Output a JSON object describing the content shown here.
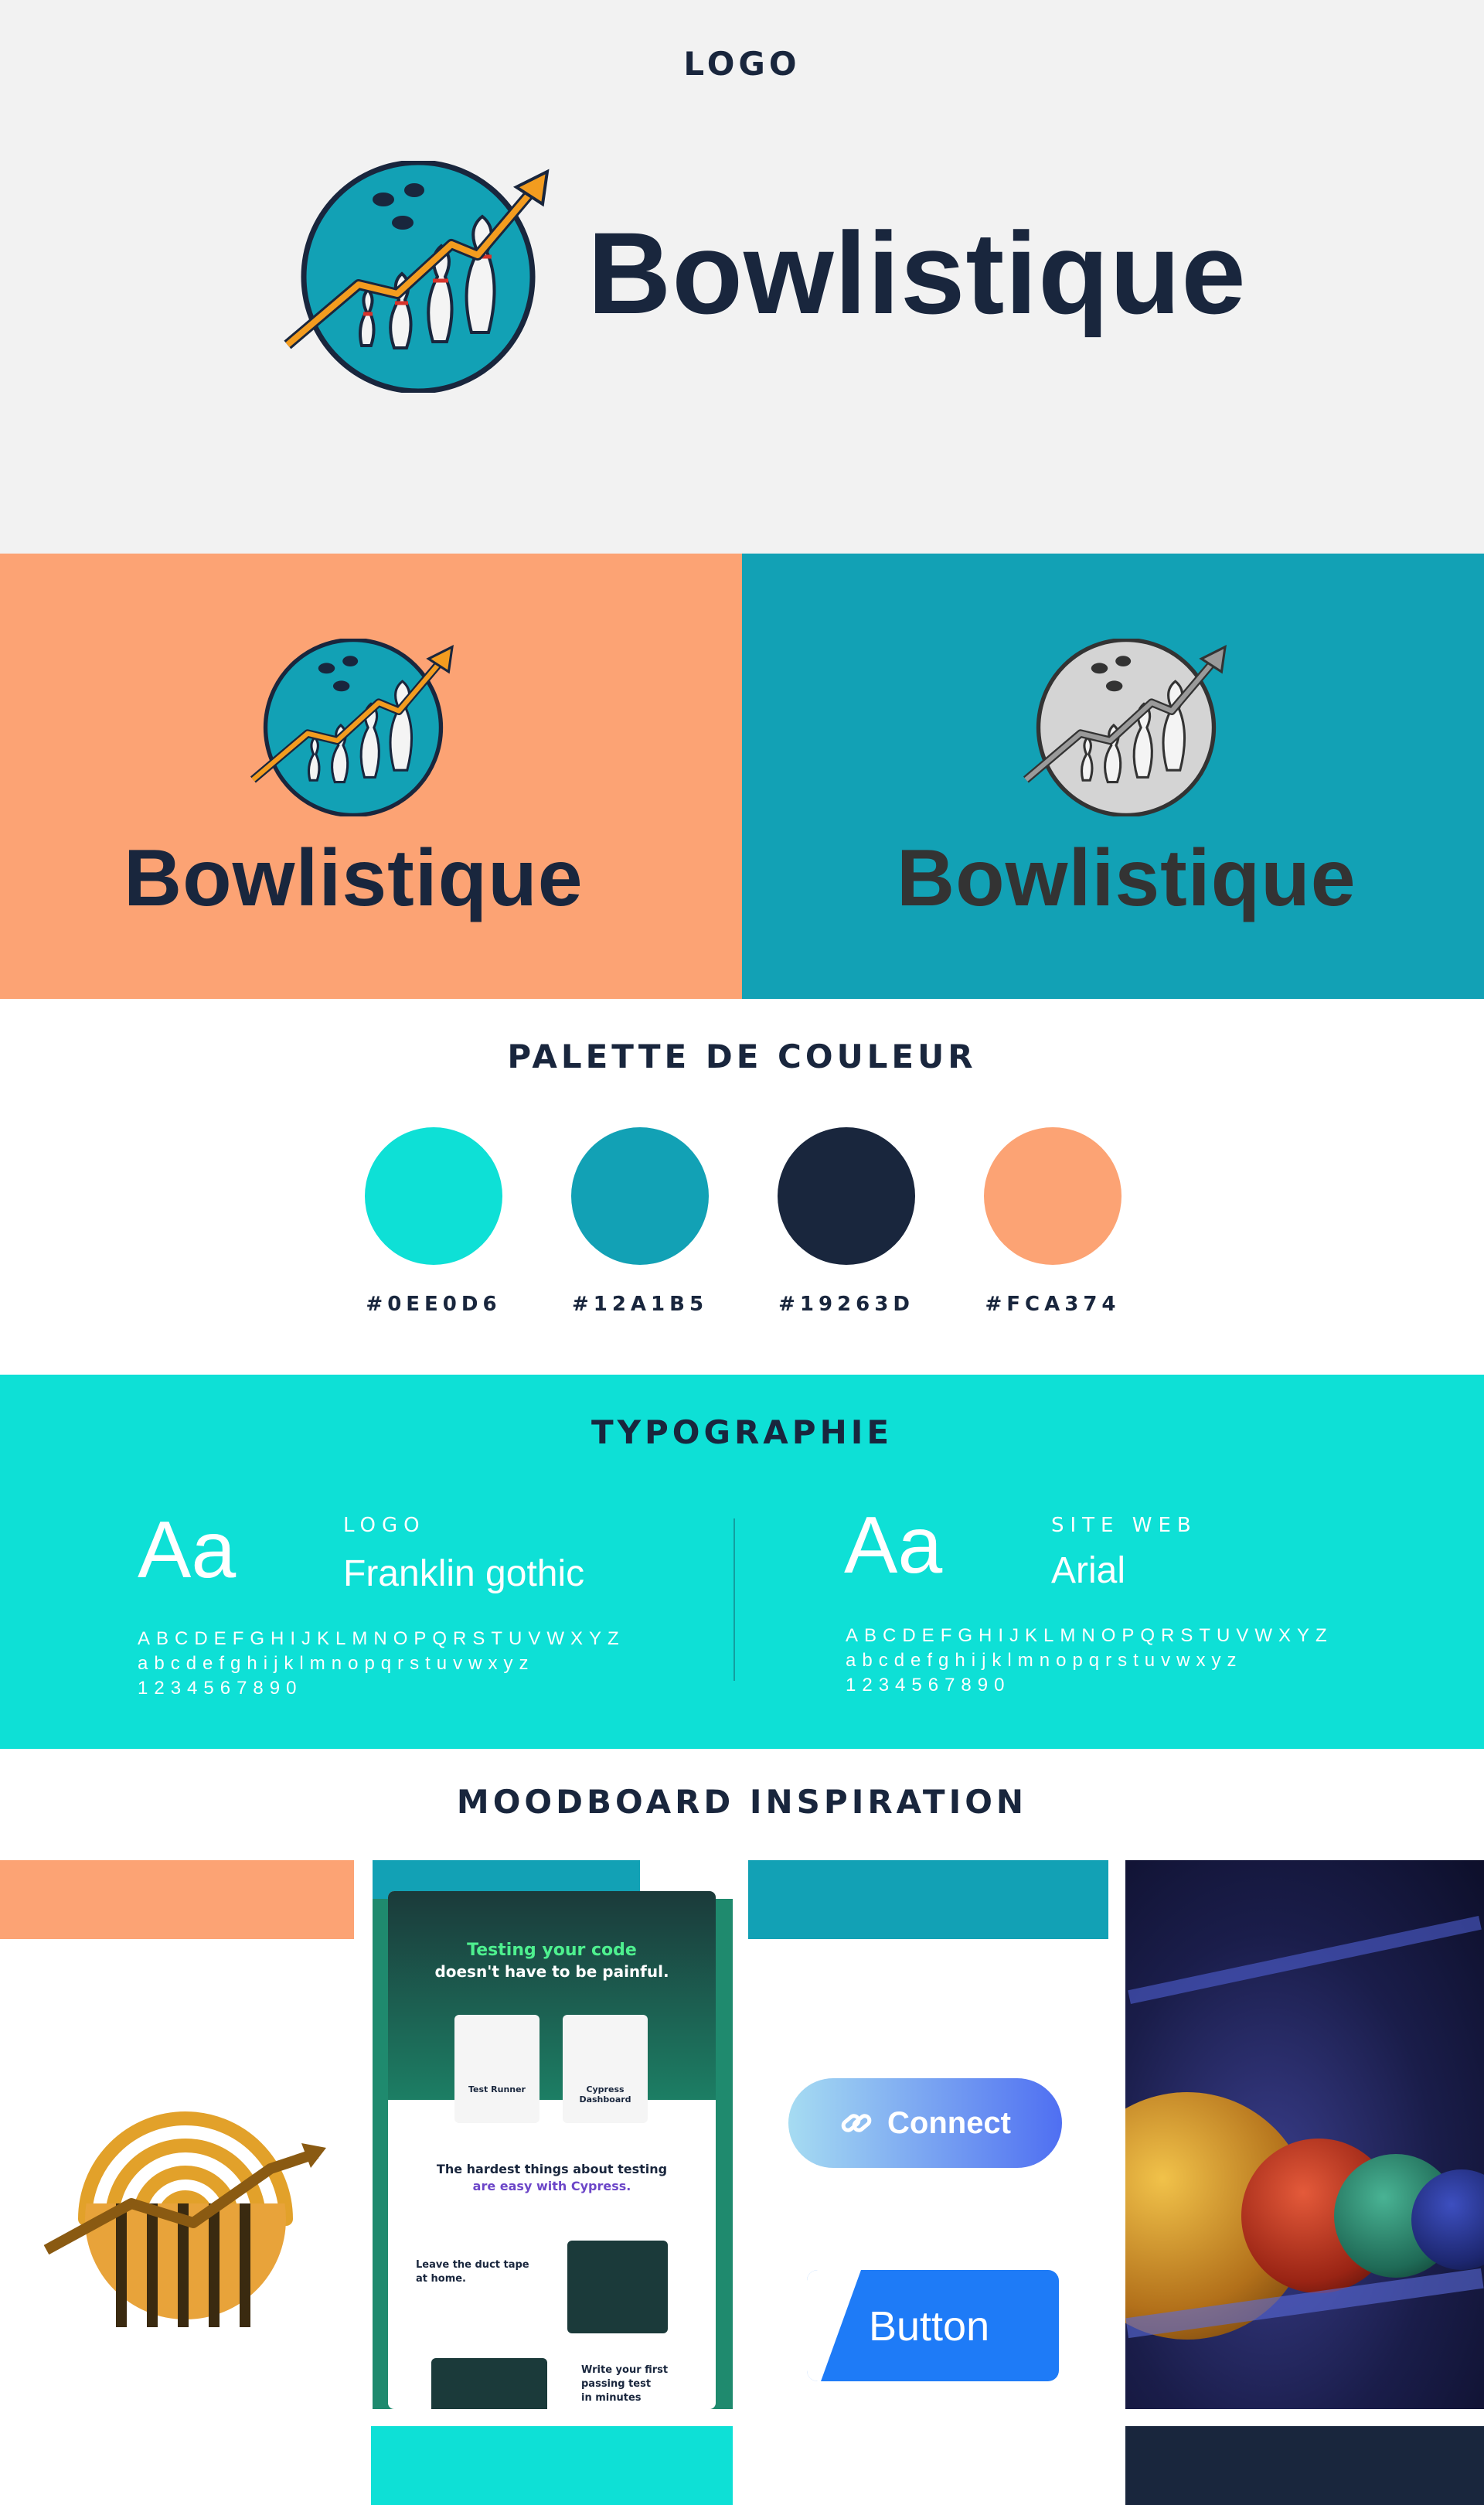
{
  "colors": {
    "turquoise": "#0EE0D6",
    "teal": "#12A1B5",
    "navy": "#19263D",
    "peach": "#FCA374"
  },
  "logo_section": {
    "title": "LOGO",
    "wordmark": "Bowlistique",
    "mark_icon": "bowling-ball-pins-arrow-icon"
  },
  "variants": {
    "orange_wordmark": "Bowlistique",
    "teal_wordmark": "Bowlistique"
  },
  "palette": {
    "title": "PALETTE DE COULEUR",
    "swatches": [
      {
        "hex": "#0EE0D6",
        "label": "#0EE0D6"
      },
      {
        "hex": "#12A1B5",
        "label": "#12A1B5"
      },
      {
        "hex": "#19263D",
        "label": "#19263D"
      },
      {
        "hex": "#FCA374",
        "label": "#FCA374"
      }
    ]
  },
  "typography": {
    "title": "TYPOGRAPHIE",
    "left": {
      "sample": "Aa",
      "category": "LOGO",
      "font_name": "Franklin gothic",
      "upper": "ABCDEFGHIJKLMNOPQRSTUVWXYZ",
      "lower": "abcdefghijklmnopqrstuvwxyz",
      "digits": "1234567890"
    },
    "right": {
      "sample": "Aa",
      "category": "SITE WEB",
      "font_name": "Arial",
      "upper": "ABCDEFGHIJKLMNOPQRSTUVWXYZ",
      "lower": "abcdefghijklmnopqrstuvwxyz",
      "digits": "1234567890"
    }
  },
  "moodboard": {
    "title": "MOODBOARD INSPIRATION",
    "website": {
      "headline_1": "Testing your code",
      "headline_2": "doesn't have to be painful.",
      "card_1": "Test Runner",
      "card_2": "Cypress Dashboard",
      "section_1": "The hardest things about testing",
      "section_1b": "are easy with Cypress.",
      "feature_1a": "Leave the duct tape",
      "feature_1b": "at home.",
      "feature_2a": "Write your first",
      "feature_2b": "passing test",
      "feature_2c": "in minutes"
    },
    "connect_button": "Connect",
    "connect_icon": "link-icon",
    "plain_button": "Button"
  }
}
